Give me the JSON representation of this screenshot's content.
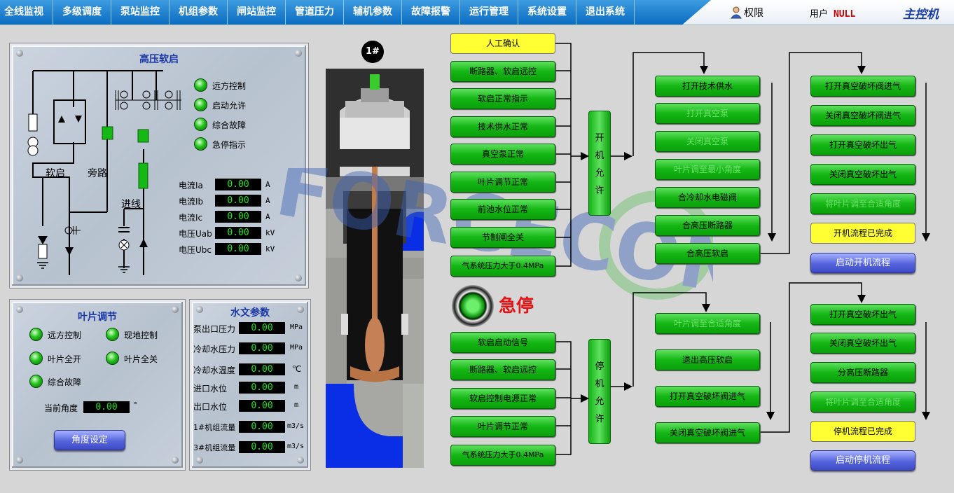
{
  "menu": [
    "全线监视",
    "多级调度",
    "泵站监控",
    "机组参数",
    "闸站监控",
    "管道压力",
    "辅机参数",
    "故障报警",
    "运行管理",
    "系统设置",
    "退出系统"
  ],
  "header": {
    "rights_label": "权限",
    "user_label": "用户",
    "user_value": "NULL",
    "station": "主控机"
  },
  "hv_panel": {
    "title": "高压软启",
    "diagram_labels": {
      "soft": "软启",
      "bypass": "旁路",
      "incoming": "进线"
    },
    "indicators": [
      "远方控制",
      "启动允许",
      "综合故障",
      "急停指示"
    ],
    "measures": [
      {
        "label": "电流Ia",
        "value": "0.00",
        "unit": "A"
      },
      {
        "label": "电流Ib",
        "value": "0.00",
        "unit": "A"
      },
      {
        "label": "电流Ic",
        "value": "0.00",
        "unit": "A"
      },
      {
        "label": "电压Uab",
        "value": "0.00",
        "unit": "kV"
      },
      {
        "label": "电压Ubc",
        "value": "0.00",
        "unit": "kV"
      }
    ]
  },
  "blade_panel": {
    "title": "叶片调节",
    "indicators": [
      "远方控制",
      "现地控制",
      "叶片全开",
      "叶片全关",
      "综合故障"
    ],
    "angle_label": "当前角度",
    "angle_value": "0.00",
    "angle_unit": "°",
    "button": "角度设定"
  },
  "hydro_panel": {
    "title": "水文参数",
    "rows": [
      {
        "label": "泵出口压力",
        "value": "0.00",
        "unit": "MPa"
      },
      {
        "label": "冷却水压力",
        "value": "0.00",
        "unit": "MPa"
      },
      {
        "label": "冷却水温度",
        "value": "0.00",
        "unit": "℃"
      },
      {
        "label": "进口水位",
        "value": "0.00",
        "unit": "m"
      },
      {
        "label": "出口水位",
        "value": "0.00",
        "unit": "m"
      },
      {
        "label": "1#机组流量",
        "value": "0.00",
        "unit": "m3/s"
      },
      {
        "label": "3#机组流量",
        "value": "0.00",
        "unit": "m3/s"
      }
    ]
  },
  "unit_no": "1#",
  "start_conditions": [
    "人工确认",
    "断路器、软启远控",
    "软启正常指示",
    "技术供水正常",
    "真空泵正常",
    "叶片调节正常",
    "前池水位正常",
    "节制闸全关",
    "气系统压力大于0.4MPa"
  ],
  "start_permit": [
    "开",
    "机",
    "允",
    "许"
  ],
  "start_seq_1": [
    "打开技术供水",
    "打开真空泵",
    "关闭真空泵",
    "叶片调至最小角度",
    "合冷却水电磁阀",
    "合高压断路器",
    "合高压软启"
  ],
  "start_seq_2": [
    "打开真空破坏阀进气",
    "关闭真空破坏阀进气",
    "打开真空破坏出气",
    "关闭真空破坏出气",
    "将叶片调至合适角度"
  ],
  "start_done": "开机流程已完成",
  "start_button": "启动开机流程",
  "estop_label": "急停",
  "stop_conditions": [
    "软启启动信号",
    "断路器、软启远控",
    "软启控制电源正常",
    "叶片调节正常",
    "气系统压力大于0.4MPa"
  ],
  "stop_permit": [
    "停",
    "机",
    "允",
    "许"
  ],
  "stop_seq_1": [
    "叶片调至合适角度",
    "退出高压软启",
    "打开真空破坏阀进气",
    "关闭真空破坏阀进气"
  ],
  "stop_seq_2": [
    "打开真空破坏出气",
    "关闭真空破坏出气",
    "分高压断路器",
    "将叶片调至合适角度"
  ],
  "stop_done": "停机流程已完成",
  "stop_button": "启动停机流程",
  "watermark": "FORCECON"
}
